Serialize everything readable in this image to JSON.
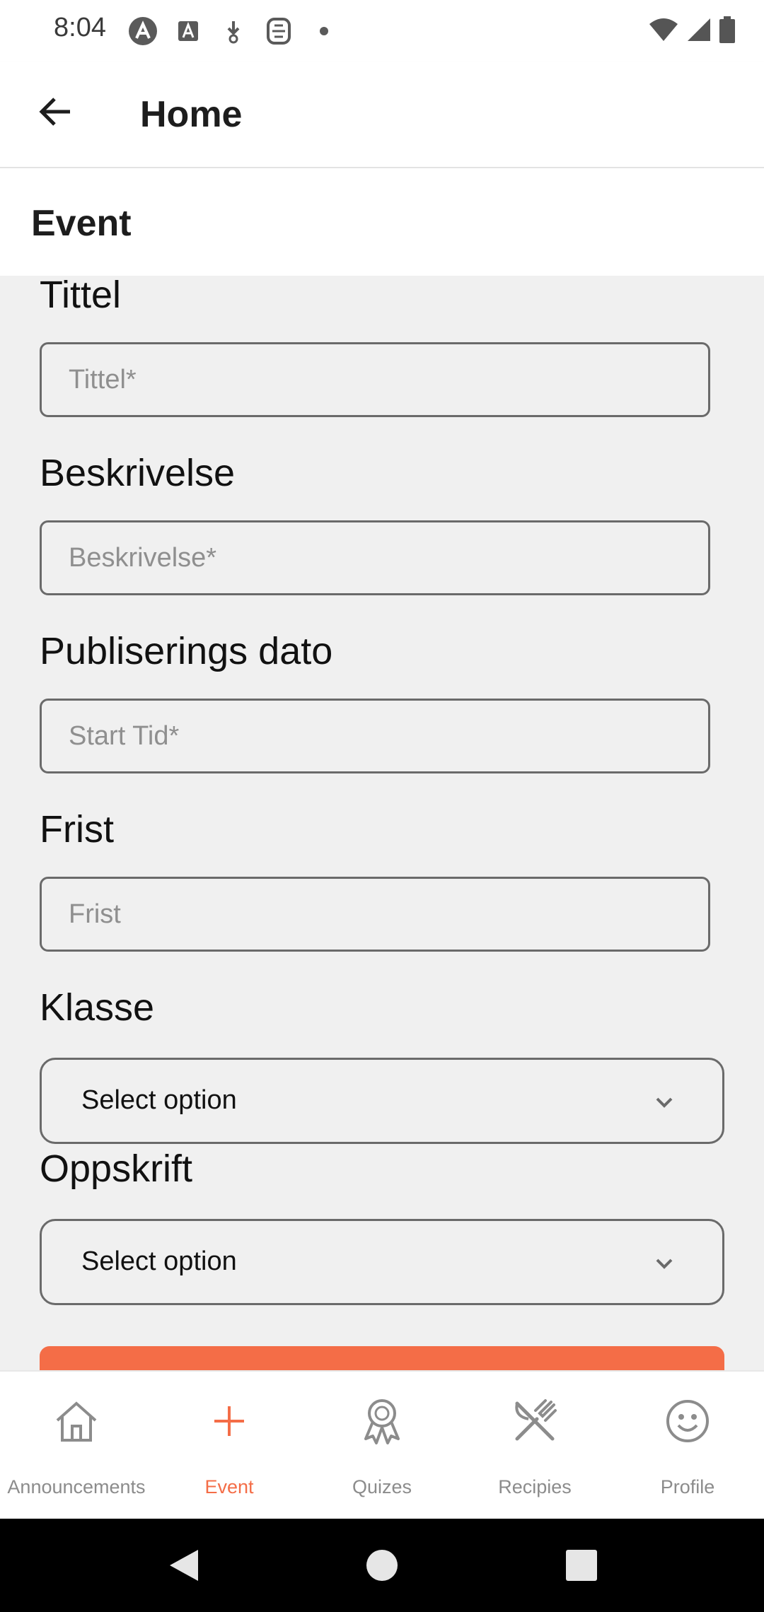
{
  "status_bar": {
    "time": "8:04"
  },
  "app_bar": {
    "title": "Home"
  },
  "section": {
    "title": "Event"
  },
  "form": {
    "fields": [
      {
        "label": "Tittel",
        "placeholder": "Tittel*",
        "value": ""
      },
      {
        "label": "Beskrivelse",
        "placeholder": "Beskrivelse*",
        "value": ""
      },
      {
        "label": "Publiserings dato",
        "placeholder": "Start Tid*",
        "value": ""
      },
      {
        "label": "Frist",
        "placeholder": "Frist",
        "value": ""
      }
    ],
    "selects": [
      {
        "label": "Klasse",
        "selected": "Select option"
      },
      {
        "label": "Oppskrift",
        "selected": "Select option"
      }
    ],
    "accent_color": "#f46d47"
  },
  "bottom_nav": {
    "items": [
      {
        "label": "Announcements",
        "icon": "home-icon",
        "active": false
      },
      {
        "label": "Event",
        "icon": "plus-icon",
        "active": true
      },
      {
        "label": "Quizes",
        "icon": "award-ribbon-icon",
        "active": false
      },
      {
        "label": "Recipies",
        "icon": "utensils-icon",
        "active": false
      },
      {
        "label": "Profile",
        "icon": "smiley-icon",
        "active": false
      }
    ]
  }
}
